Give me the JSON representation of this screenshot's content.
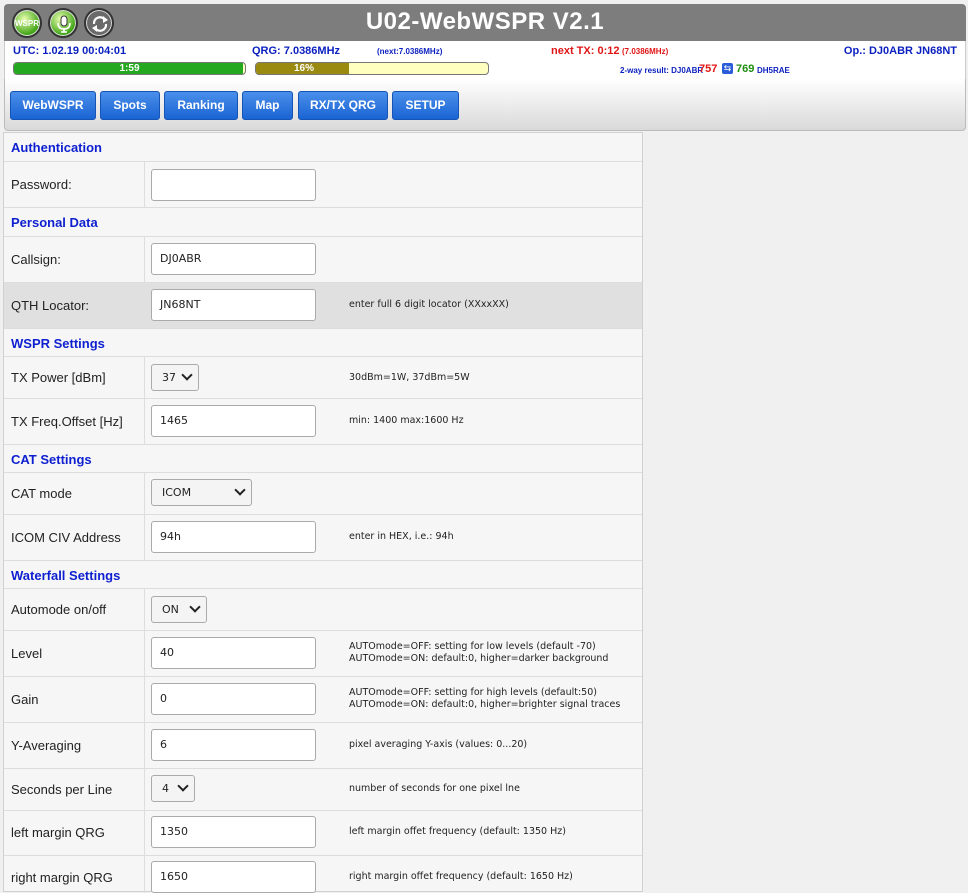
{
  "header": {
    "title": "U02-WebWSPR V2.1",
    "icons": [
      "wspr-logo-icon",
      "microphone-icon",
      "sync-icon"
    ],
    "wspr_icon_label": "WSPR"
  },
  "status": {
    "utc": "UTC: 1.02.19 00:04:01",
    "qrg": "QRG: 7.0386MHz",
    "next_qrg": "(next:7.0386MHz)",
    "next_tx": "next TX: 0:12",
    "next_tx_qrg": "(7.0386MHz)",
    "operator": "Op.: DJ0ABR JN68NT",
    "timer_bar": {
      "label": "1:59",
      "fraction": 0.99
    },
    "progress_bar": {
      "label": "16%",
      "fraction": 0.4
    },
    "two_way_label": "2-way result: DJ0ABR",
    "two_way_rx": "757",
    "two_way_tx": "769",
    "two_way_partner": "DH5RAE"
  },
  "nav": {
    "items": [
      "WebWSPR",
      "Spots",
      "Ranking",
      "Map",
      "RX/TX QRG",
      "SETUP"
    ]
  },
  "sections": {
    "auth": "Authentication",
    "personal": "Personal Data",
    "wspr": "WSPR Settings",
    "cat": "CAT Settings",
    "waterfall": "Waterfall Settings"
  },
  "fields": {
    "password": {
      "label": "Password:",
      "value": ""
    },
    "callsign": {
      "label": "Callsign:",
      "value": "DJ0ABR"
    },
    "qth": {
      "label": "QTH Locator:",
      "value": "JN68NT",
      "hint": "enter full 6 digit locator (XXxxXX)"
    },
    "tx_power": {
      "label": "TX Power [dBm]",
      "value": "37",
      "hint": "30dBm=1W, 37dBm=5W"
    },
    "tx_offset": {
      "label": "TX Freq.Offset [Hz]",
      "value": "1465",
      "hint": "min: 1400 max:1600 Hz"
    },
    "cat_mode": {
      "label": "CAT mode",
      "value": "ICOM"
    },
    "civ": {
      "label": "ICOM CIV Address",
      "value": "94h",
      "hint": "enter in HEX, i.e.: 94h"
    },
    "automode": {
      "label": "Automode on/off",
      "value": "ON"
    },
    "level": {
      "label": "Level",
      "value": "40",
      "hint1": "AUTOmode=OFF: setting for low levels (default -70)",
      "hint2": "AUTOmode=ON: default:0, higher=darker background"
    },
    "gain": {
      "label": "Gain",
      "value": "0",
      "hint1": "AUTOmode=OFF: setting for high levels (default:50)",
      "hint2": "AUTOmode=ON: default:0, higher=brighter signal traces"
    },
    "yavg": {
      "label": "Y-Averaging",
      "value": "6",
      "hint": "pixel averaging Y-axis (values: 0...20)"
    },
    "spl": {
      "label": "Seconds per Line",
      "value": "4",
      "hint": "number of seconds for one pixel lne"
    },
    "left_margin": {
      "label": "left margin QRG",
      "value": "1350",
      "hint": "left margin offet frequency (default: 1350 Hz)"
    },
    "right_margin": {
      "label": "right margin QRG",
      "value": "1650",
      "hint": "right margin offet frequency (default: 1650 Hz)"
    }
  },
  "colors": {
    "header_bg": "#7d7d7d",
    "accent_blue": "#1a64d4",
    "section_title": "#0d1fd0",
    "status_red": "#e01515",
    "status_green": "#1f8f10",
    "timer_fill": "#23a81f",
    "progress_fill": "#9a8a10"
  }
}
